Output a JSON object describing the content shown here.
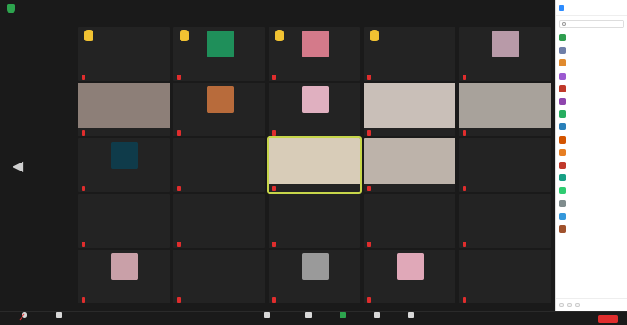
{
  "grid": {
    "tiles": [
      {
        "id": 1,
        "style": "name",
        "hand": true,
        "center": "",
        "tag": ""
      },
      {
        "id": 2,
        "style": "thumb",
        "hand": true,
        "thumb_color": "#1f8f5a",
        "tag": ""
      },
      {
        "id": 3,
        "style": "thumb",
        "hand": true,
        "thumb_color": "#d47a8a",
        "tag": ""
      },
      {
        "id": 4,
        "style": "name",
        "hand": true,
        "center": "",
        "tag": ""
      },
      {
        "id": 5,
        "style": "thumb",
        "hand": false,
        "thumb_color": "#b89aa8",
        "tag": ""
      },
      {
        "id": 6,
        "style": "video",
        "hand": false,
        "video_color": "#8d7f78",
        "tag": ""
      },
      {
        "id": 7,
        "style": "thumb",
        "hand": false,
        "thumb_color": "#b86b3b",
        "tag": ""
      },
      {
        "id": 8,
        "style": "thumb",
        "hand": false,
        "thumb_color": "#e0b0c0",
        "tag": ""
      },
      {
        "id": 9,
        "style": "video",
        "hand": false,
        "video_color": "#c9bfb8",
        "tag": ""
      },
      {
        "id": 10,
        "style": "video",
        "hand": false,
        "video_color": "#a8a29b",
        "tag": ""
      },
      {
        "id": 11,
        "style": "thumb",
        "hand": false,
        "thumb_color": "#0f3b4a",
        "tag": ""
      },
      {
        "id": 12,
        "style": "name",
        "hand": false,
        "center": "",
        "tag": ""
      },
      {
        "id": 13,
        "style": "video",
        "hand": false,
        "video_color": "#d8ccb8",
        "active": true,
        "tag": ""
      },
      {
        "id": 14,
        "style": "video",
        "hand": false,
        "video_color": "#bdb3aa",
        "tag": ""
      },
      {
        "id": 15,
        "style": "name",
        "hand": false,
        "center": "",
        "tag": ""
      },
      {
        "id": 16,
        "style": "name",
        "hand": false,
        "center": "",
        "tag": ""
      },
      {
        "id": 17,
        "style": "name",
        "hand": false,
        "center": "",
        "tag": ""
      },
      {
        "id": 18,
        "style": "name",
        "hand": false,
        "center": "",
        "tag": ""
      },
      {
        "id": 19,
        "style": "name",
        "hand": false,
        "center": "",
        "tag": ""
      },
      {
        "id": 20,
        "style": "name",
        "hand": false,
        "center": "",
        "tag": ""
      },
      {
        "id": 21,
        "style": "thumb",
        "hand": false,
        "thumb_color": "#c9a0a8",
        "tag": ""
      },
      {
        "id": 22,
        "style": "name",
        "hand": false,
        "center": "",
        "tag": ""
      },
      {
        "id": 23,
        "style": "thumb",
        "hand": false,
        "thumb_color": "#9a9a9a",
        "tag": ""
      },
      {
        "id": 24,
        "style": "thumb",
        "hand": false,
        "thumb_color": "#e0a8b8",
        "tag": ""
      },
      {
        "id": 25,
        "style": "name",
        "hand": false,
        "center": "",
        "tag": ""
      }
    ]
  },
  "panel": {
    "title": "",
    "search_placeholder": "",
    "participants": [
      {
        "initials": "",
        "color": "#2e9e4f",
        "name": ""
      },
      {
        "initials": "",
        "color": "#6f7fa8",
        "name": ""
      },
      {
        "initials": "",
        "color": "#e08a2e",
        "name": ""
      },
      {
        "initials": "",
        "color": "#9b59d0",
        "name": ""
      },
      {
        "initials": "",
        "color": "#c0392b",
        "name": ""
      },
      {
        "initials": "",
        "color": "#8e44ad",
        "name": ""
      },
      {
        "initials": "",
        "color": "#27ae60",
        "name": ""
      },
      {
        "initials": "",
        "color": "#2980b9",
        "name": ""
      },
      {
        "initials": "",
        "color": "#d35400",
        "name": ""
      },
      {
        "initials": "",
        "color": "#e67e22",
        "name": ""
      },
      {
        "initials": "",
        "color": "#c0392b",
        "name": ""
      },
      {
        "initials": "",
        "color": "#16a085",
        "name": ""
      },
      {
        "initials": "",
        "color": "#2ecc71",
        "name": ""
      },
      {
        "initials": "",
        "color": "#7f8c8d",
        "name": ""
      },
      {
        "initials": "",
        "color": "#3498db",
        "name": ""
      },
      {
        "initials": "",
        "color": "#a0522d",
        "name": ""
      }
    ],
    "footer": {
      "invite": "",
      "unmute": "",
      "more": ""
    }
  },
  "bottom_bar": {
    "unmute": "",
    "start_video": "",
    "participants": "",
    "participants_count": "",
    "chat": "",
    "share_screen": "",
    "record": "",
    "reactions": "",
    "leave": ""
  },
  "colors": {
    "accent_green": "#2da44e",
    "leave_red": "#e02d2d",
    "active_speaker": "#c7d64a"
  }
}
